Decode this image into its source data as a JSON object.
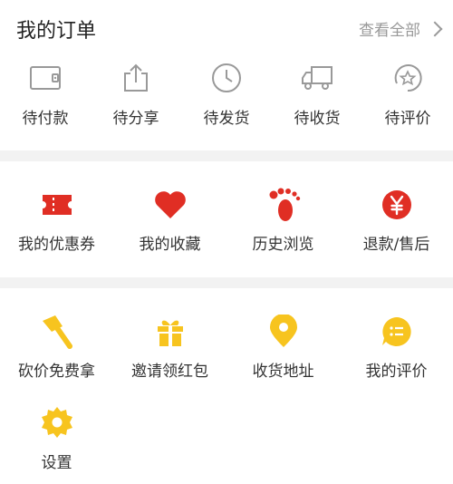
{
  "orders": {
    "title": "我的订单",
    "view_all": "查看全部",
    "items": [
      {
        "label": "待付款",
        "icon": "wallet-icon"
      },
      {
        "label": "待分享",
        "icon": "share-icon"
      },
      {
        "label": "待发货",
        "icon": "clock-icon"
      },
      {
        "label": "待收货",
        "icon": "truck-icon"
      },
      {
        "label": "待评价",
        "icon": "review-star-icon"
      }
    ]
  },
  "services": {
    "items": [
      {
        "label": "我的优惠券",
        "icon": "coupon-icon"
      },
      {
        "label": "我的收藏",
        "icon": "heart-icon"
      },
      {
        "label": "历史浏览",
        "icon": "footprint-icon"
      },
      {
        "label": "退款/售后",
        "icon": "yuan-icon"
      }
    ]
  },
  "tools": {
    "items": [
      {
        "label": "砍价免费拿",
        "icon": "axe-icon"
      },
      {
        "label": "邀请领红包",
        "icon": "gift-icon"
      },
      {
        "label": "收货地址",
        "icon": "location-pin-icon"
      },
      {
        "label": "我的评价",
        "icon": "comment-bubble-icon"
      },
      {
        "label": "设置",
        "icon": "gear-icon"
      }
    ]
  },
  "colors": {
    "accent_red": "#e02e24",
    "accent_yellow": "#f7c41f",
    "gray_icon": "#999999",
    "background": "#f2f2f2"
  }
}
